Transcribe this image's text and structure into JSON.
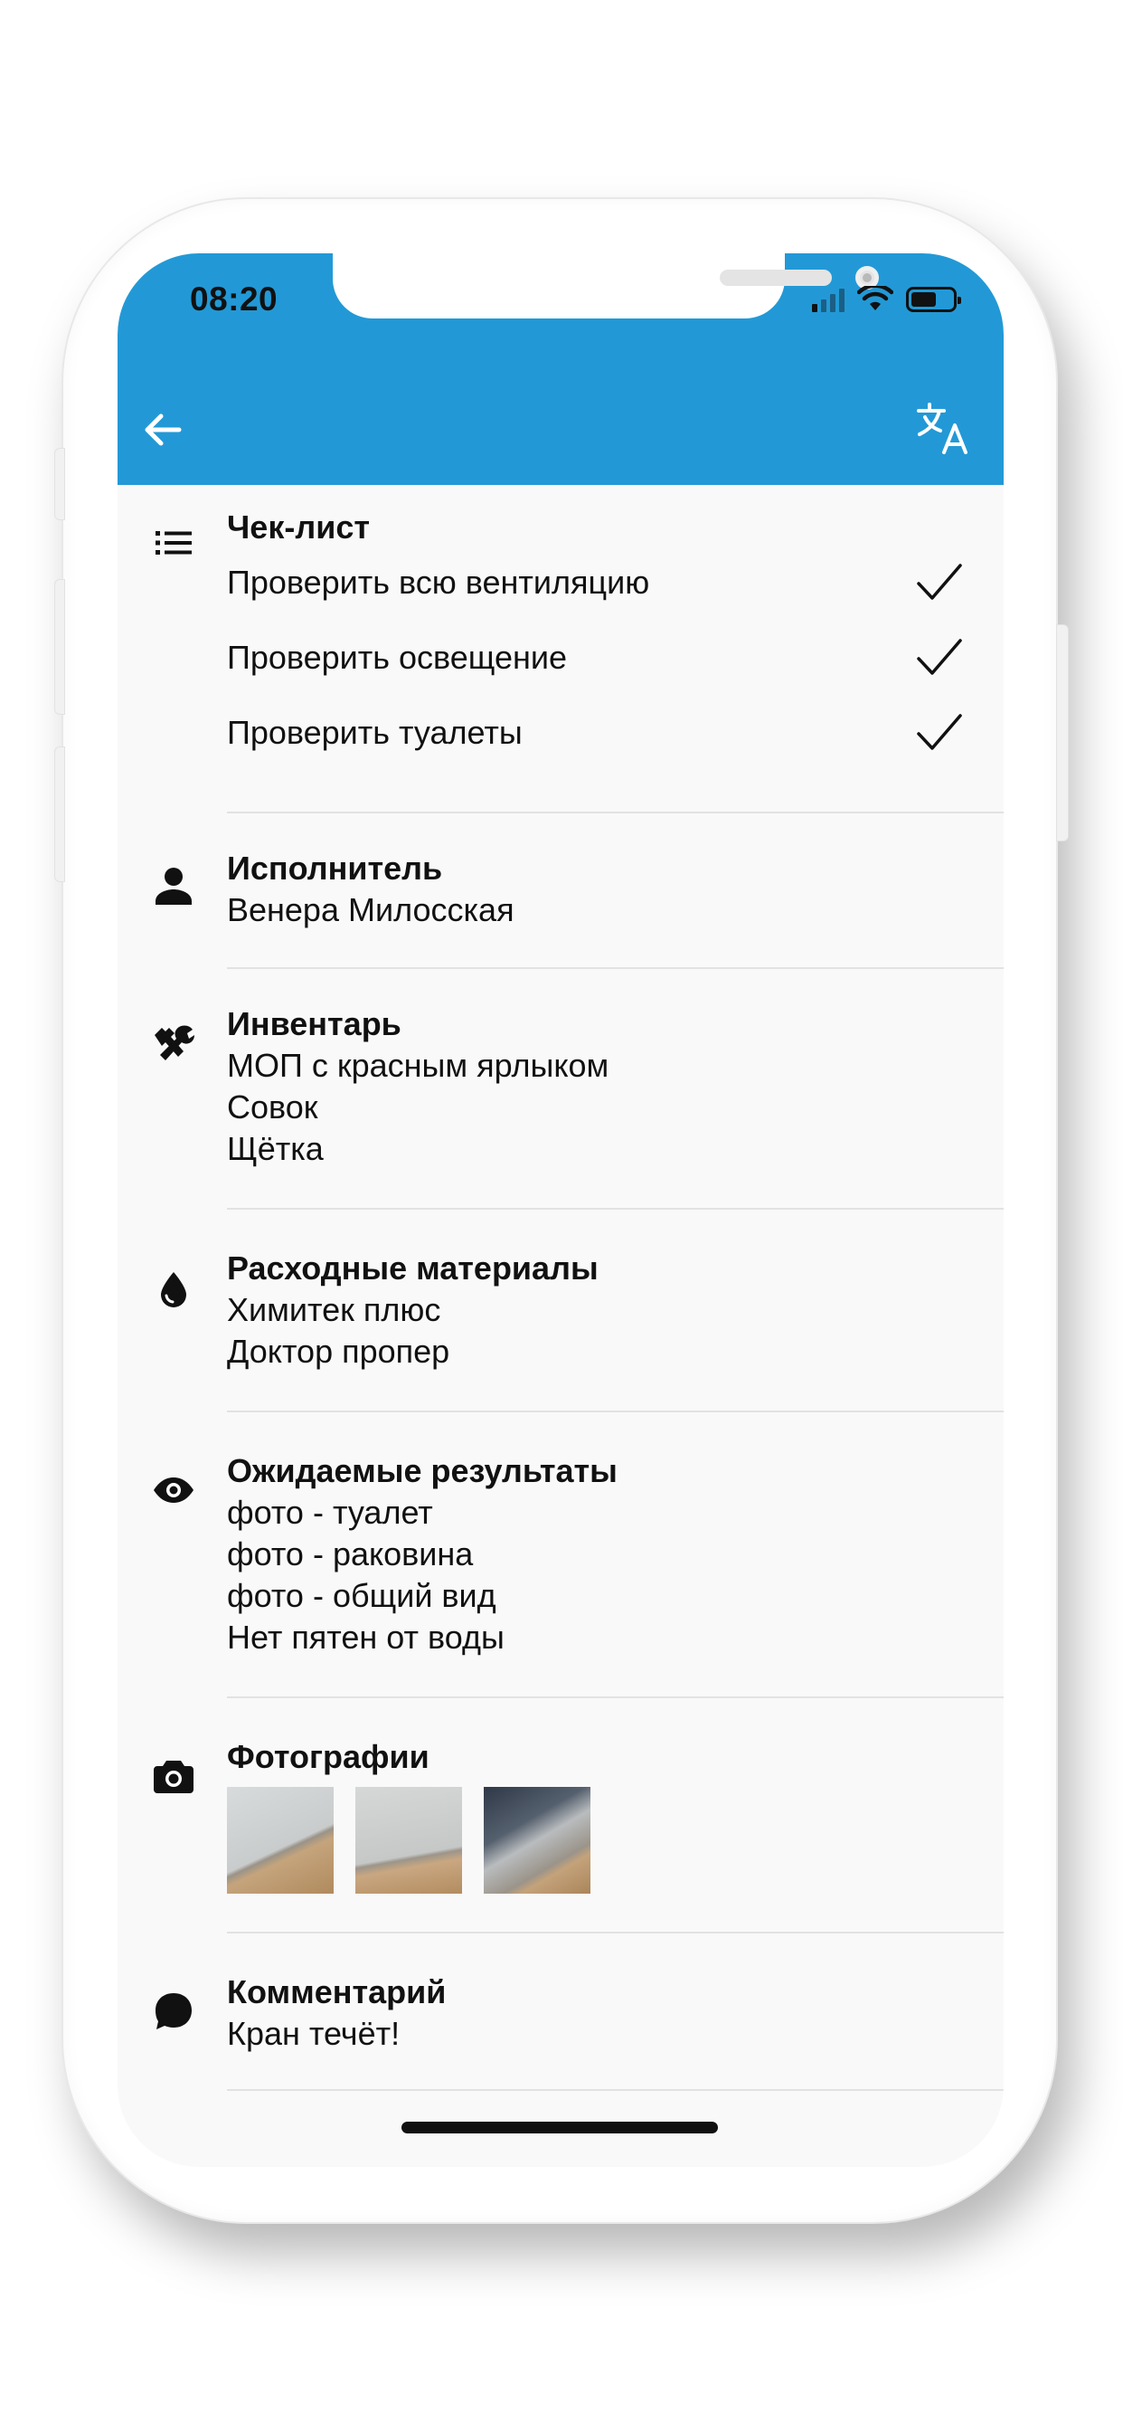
{
  "status_bar": {
    "time": "08:20"
  },
  "checklist": {
    "title": "Чек-лист",
    "items": [
      {
        "label": "Проверить всю вентиляцию",
        "checked": true
      },
      {
        "label": "Проверить освещение",
        "checked": true
      },
      {
        "label": "Проверить туалеты",
        "checked": true
      }
    ]
  },
  "assignee": {
    "title": "Исполнитель",
    "value": "Венера Милосская"
  },
  "inventory": {
    "title": "Инвентарь",
    "items": [
      "МОП с красным ярлыком",
      "Совок",
      "Щётка"
    ]
  },
  "consumables": {
    "title": "Расходные материалы",
    "items": [
      "Химитек плюс",
      "Доктор пропер"
    ]
  },
  "expected_results": {
    "title": "Ожидаемые результаты",
    "items": [
      "фото - туалет",
      "фото - раковина",
      "фото - общий вид",
      "Нет пятен от воды"
    ]
  },
  "photos": {
    "title": "Фотографии"
  },
  "comment": {
    "title": "Комментарий",
    "value": "Кран течёт!"
  },
  "colors": {
    "header": "#2299d6",
    "background": "#f9f9f9",
    "text": "#111111",
    "divider": "#e2e2e2"
  },
  "icons": {
    "checklist": "list-icon",
    "assignee": "person-icon",
    "inventory": "tools-icon",
    "consumables": "drop-icon",
    "expected_results": "eye-icon",
    "photos": "camera-icon",
    "comment": "chat-bubble-icon"
  }
}
